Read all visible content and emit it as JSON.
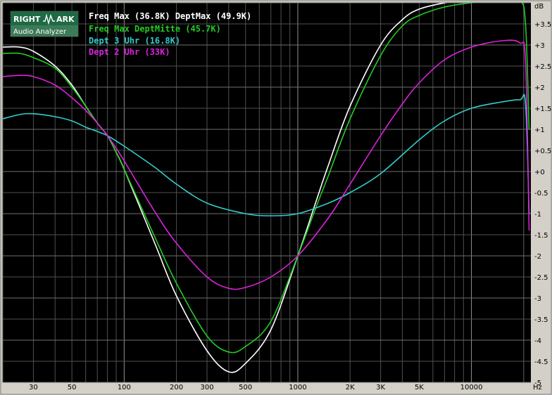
{
  "logo": {
    "line1_left": "RIGHT",
    "line1_right": "ARK",
    "line2": "Audio Analyzer"
  },
  "chart_data": {
    "type": "line",
    "xscale": "log",
    "xlim": [
      20,
      22000
    ],
    "ylim": [
      -5,
      4
    ],
    "xlabel": "",
    "ylabel": "",
    "x_unit": "Hz",
    "y_unit": "dB",
    "grid": true,
    "legend": "top-left",
    "x_tick_labels": [
      {
        "v": 30,
        "t": "30"
      },
      {
        "v": 50,
        "t": "50"
      },
      {
        "v": 100,
        "t": "100"
      },
      {
        "v": 200,
        "t": "200"
      },
      {
        "v": 300,
        "t": "300"
      },
      {
        "v": 500,
        "t": "500"
      },
      {
        "v": 1000,
        "t": "1000"
      },
      {
        "v": 2000,
        "t": "2K"
      },
      {
        "v": 3000,
        "t": "3K"
      },
      {
        "v": 5000,
        "t": "5K"
      },
      {
        "v": 10000,
        "t": "10000"
      }
    ],
    "y_tick_labels": [
      {
        "v": 3.5,
        "t": "+3.5"
      },
      {
        "v": 3,
        "t": "+3"
      },
      {
        "v": 2.5,
        "t": "+2.5"
      },
      {
        "v": 2,
        "t": "+2"
      },
      {
        "v": 1.5,
        "t": "+1.5"
      },
      {
        "v": 1,
        "t": "+1"
      },
      {
        "v": 0.5,
        "t": "+0.5"
      },
      {
        "v": 0,
        "t": "+0"
      },
      {
        "v": -0.5,
        "t": "-0.5"
      },
      {
        "v": -1,
        "t": "-1"
      },
      {
        "v": -1.5,
        "t": "-1.5"
      },
      {
        "v": -2,
        "t": "-2"
      },
      {
        "v": -2.5,
        "t": "-2.5"
      },
      {
        "v": -3,
        "t": "-3"
      },
      {
        "v": -3.5,
        "t": "-3.5"
      },
      {
        "v": -4,
        "t": "-4"
      },
      {
        "v": -4.5,
        "t": "-4.5"
      },
      {
        "v": -5,
        "t": "-5"
      }
    ],
    "series": [
      {
        "name": "Freq Max (36.8K) DeptMax (49.9K)",
        "color": "#ffffff",
        "points": [
          [
            20,
            2.95
          ],
          [
            25,
            2.95
          ],
          [
            30,
            2.85
          ],
          [
            40,
            2.5
          ],
          [
            50,
            2.05
          ],
          [
            60,
            1.55
          ],
          [
            70,
            1.15
          ],
          [
            80,
            0.85
          ],
          [
            90,
            0.45
          ],
          [
            100,
            0.05
          ],
          [
            150,
            -1.7
          ],
          [
            200,
            -2.95
          ],
          [
            300,
            -4.25
          ],
          [
            400,
            -4.75
          ],
          [
            500,
            -4.55
          ],
          [
            700,
            -3.75
          ],
          [
            1000,
            -2.0
          ],
          [
            1300,
            -0.6
          ],
          [
            1500,
            0.15
          ],
          [
            2000,
            1.55
          ],
          [
            3000,
            3.0
          ],
          [
            4000,
            3.6
          ],
          [
            5000,
            3.85
          ],
          [
            7000,
            4.0
          ],
          [
            10000,
            4.1
          ],
          [
            15000,
            4.15
          ],
          [
            20000,
            4.15
          ]
        ]
      },
      {
        "name": "Freq Max DeptMitte (45.7K)",
        "color": "#22cc22",
        "points": [
          [
            20,
            2.8
          ],
          [
            25,
            2.8
          ],
          [
            30,
            2.7
          ],
          [
            40,
            2.45
          ],
          [
            50,
            2.0
          ],
          [
            60,
            1.55
          ],
          [
            70,
            1.15
          ],
          [
            80,
            0.85
          ],
          [
            90,
            0.45
          ],
          [
            100,
            0.05
          ],
          [
            150,
            -1.55
          ],
          [
            200,
            -2.65
          ],
          [
            300,
            -3.9
          ],
          [
            400,
            -4.28
          ],
          [
            500,
            -4.15
          ],
          [
            700,
            -3.55
          ],
          [
            1000,
            -2.0
          ],
          [
            1300,
            -0.75
          ],
          [
            1500,
            -0.1
          ],
          [
            2000,
            1.25
          ],
          [
            3000,
            2.75
          ],
          [
            4000,
            3.45
          ],
          [
            5000,
            3.7
          ],
          [
            7000,
            3.9
          ],
          [
            10000,
            4.0
          ],
          [
            15000,
            4.05
          ],
          [
            19000,
            4.05
          ],
          [
            20500,
            3.5
          ],
          [
            21500,
            1.0
          ]
        ]
      },
      {
        "name": "Dept 3 Uhr (16.8K)",
        "color": "#33cccc",
        "points": [
          [
            20,
            1.25
          ],
          [
            25,
            1.35
          ],
          [
            30,
            1.37
          ],
          [
            40,
            1.3
          ],
          [
            50,
            1.2
          ],
          [
            60,
            1.05
          ],
          [
            70,
            0.95
          ],
          [
            80,
            0.85
          ],
          [
            100,
            0.6
          ],
          [
            150,
            0.1
          ],
          [
            200,
            -0.3
          ],
          [
            300,
            -0.75
          ],
          [
            500,
            -1.0
          ],
          [
            700,
            -1.05
          ],
          [
            1000,
            -1.0
          ],
          [
            1500,
            -0.75
          ],
          [
            2000,
            -0.5
          ],
          [
            3000,
            -0.05
          ],
          [
            5000,
            0.75
          ],
          [
            7000,
            1.2
          ],
          [
            10000,
            1.5
          ],
          [
            15000,
            1.65
          ],
          [
            19000,
            1.7
          ],
          [
            20500,
            1.6
          ],
          [
            21500,
            -1.0
          ]
        ]
      },
      {
        "name": "Dept 2 Uhr (33K)",
        "color": "#dd22dd",
        "points": [
          [
            20,
            2.25
          ],
          [
            25,
            2.28
          ],
          [
            30,
            2.25
          ],
          [
            40,
            2.05
          ],
          [
            50,
            1.75
          ],
          [
            60,
            1.45
          ],
          [
            70,
            1.15
          ],
          [
            80,
            0.85
          ],
          [
            90,
            0.55
          ],
          [
            100,
            0.25
          ],
          [
            150,
            -0.95
          ],
          [
            200,
            -1.7
          ],
          [
            300,
            -2.5
          ],
          [
            400,
            -2.77
          ],
          [
            500,
            -2.75
          ],
          [
            700,
            -2.5
          ],
          [
            1000,
            -2.0
          ],
          [
            1500,
            -1.1
          ],
          [
            2000,
            -0.3
          ],
          [
            3000,
            0.85
          ],
          [
            4000,
            1.6
          ],
          [
            5000,
            2.1
          ],
          [
            7000,
            2.65
          ],
          [
            10000,
            2.95
          ],
          [
            15000,
            3.1
          ],
          [
            19000,
            3.05
          ],
          [
            20500,
            2.6
          ],
          [
            21500,
            -1.4
          ]
        ]
      }
    ]
  }
}
